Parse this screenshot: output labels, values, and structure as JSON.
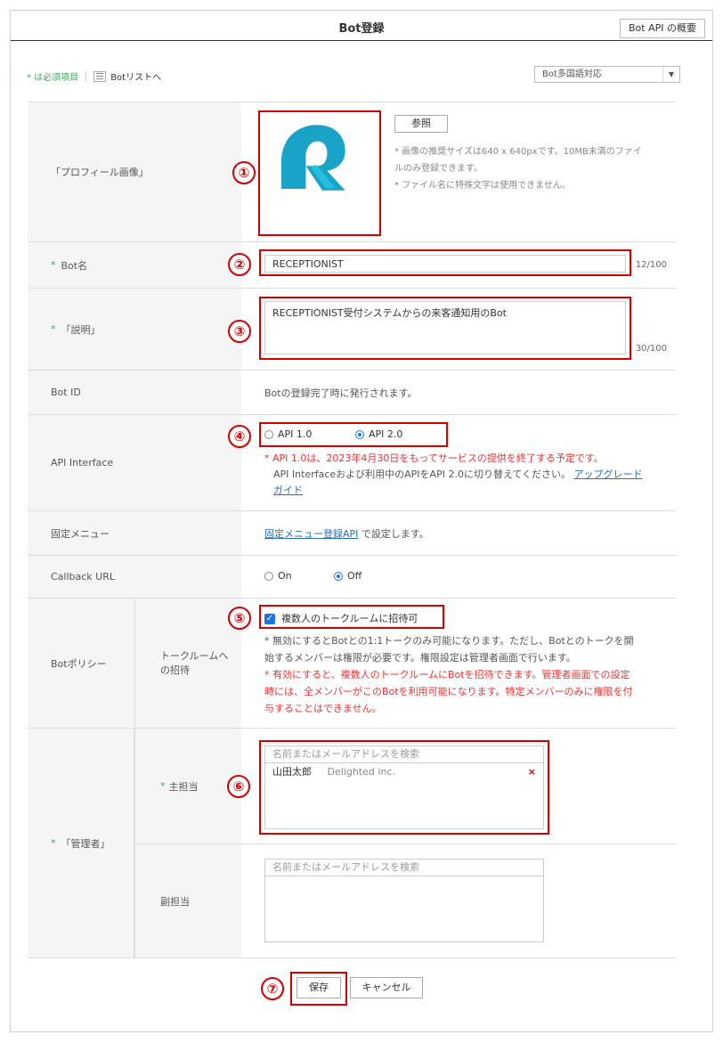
{
  "header": {
    "title": "Bot登録",
    "api_button": "Bot API の概要"
  },
  "top": {
    "required_note": "* は必須項目",
    "bot_list_link": "Botリストへ",
    "language_select": "Bot多国語対応"
  },
  "profile": {
    "label": "「プロフィール画像」",
    "browse_button": "参照",
    "hint1": "* 画像の推奨サイズは640 x 640pxです。10MB未満のファイ",
    "hint2": "ルのみ登録できます。",
    "hint3": "* ファイル名に特殊文字は使用できません。"
  },
  "bot_name": {
    "label": "Bot名",
    "value": "RECEPTIONIST",
    "counter": "12/100"
  },
  "description": {
    "label": "「説明」",
    "value": "RECEPTIONIST受付システムからの来客通知用のBot",
    "counter": "30/100"
  },
  "bot_id": {
    "label": "Bot ID",
    "value": "Botの登録完了時に発行されます。"
  },
  "api_interface": {
    "label": "API Interface",
    "option1": "API 1.0",
    "option2": "API 2.0",
    "selected": "API 2.0",
    "note1": "* API 1.0は、2023年4月30日をもってサービスの提供を終了する予定です。",
    "note2": "API Interfaceおよび利用中のAPIをAPI 2.0に切り替えてください。",
    "upgrade_link_1": "アップグレード",
    "upgrade_link_2": "ガイド"
  },
  "fixed_menu": {
    "label": "固定メニュー",
    "link": "固定メニュー登録API",
    "text": "で設定します。"
  },
  "callback": {
    "label": "Callback URL",
    "on": "On",
    "off": "Off",
    "selected": "Off"
  },
  "policy": {
    "label": "Botポリシー",
    "sublabel1": "トークルームへ",
    "sublabel2": "の招待",
    "checkbox_label": "複数人のトークルームに招待可",
    "checked": true,
    "note1": "* 無効にするとBotとの1:1トークのみ可能になります。ただし、Botとのトークを開",
    "note2": "始するメンバーは権限が必要です。権限設定は管理者画面で行います。",
    "warn1": "* 有効にすると、複数人のトークルームにBotを招待できます。管理者画面での設定",
    "warn2": "時には、全メンバーがこのBotを利用可能になります。特定メンバーのみに権限を付",
    "warn3": "与することはできません。"
  },
  "admin": {
    "label": "「管理者」",
    "primary_label": "主担当",
    "secondary_label": "副担当",
    "search_placeholder": "名前またはメールアドレスを検索",
    "primary_user": {
      "name": "山田太郎",
      "company": "Delighted inc.",
      "remove": "×"
    }
  },
  "buttons": {
    "save": "保存",
    "cancel": "キャンセル"
  },
  "annotations": [
    "①",
    "②",
    "③",
    "④",
    "⑤",
    "⑥",
    "⑦"
  ],
  "colors": {
    "accent_red": "#d40000",
    "required_green": "#3aa85a",
    "link_blue": "#2a6ebd",
    "logo_blue": "#1aa3c8"
  }
}
